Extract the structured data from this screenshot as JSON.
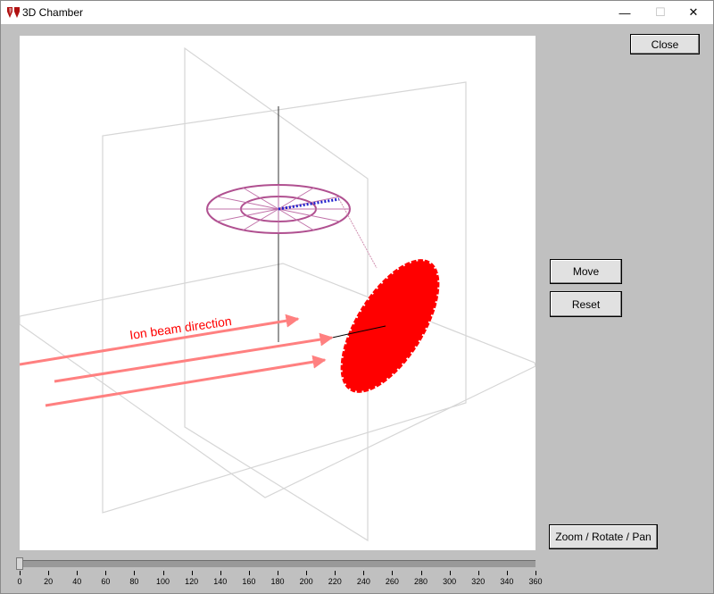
{
  "window": {
    "title": "3D Chamber",
    "minimize_glyph": "—",
    "maximize_glyph": "☐",
    "close_glyph": "✕"
  },
  "buttons": {
    "close": "Close",
    "move": "Move",
    "reset": "Reset",
    "zoom": "Zoom / Rotate / Pan"
  },
  "scene": {
    "annotation": "Ion beam direction",
    "beam_color": "#ff7f7f",
    "target_color": "#ff0000",
    "holder_color": "#b05090",
    "arm_color": "#2020cc"
  },
  "slider": {
    "value": 0,
    "min": 0,
    "max": 360,
    "labels": [
      "0",
      "20",
      "40",
      "60",
      "80",
      "100",
      "120",
      "140",
      "160",
      "180",
      "200",
      "220",
      "240",
      "260",
      "280",
      "300",
      "320",
      "340",
      "360"
    ]
  }
}
